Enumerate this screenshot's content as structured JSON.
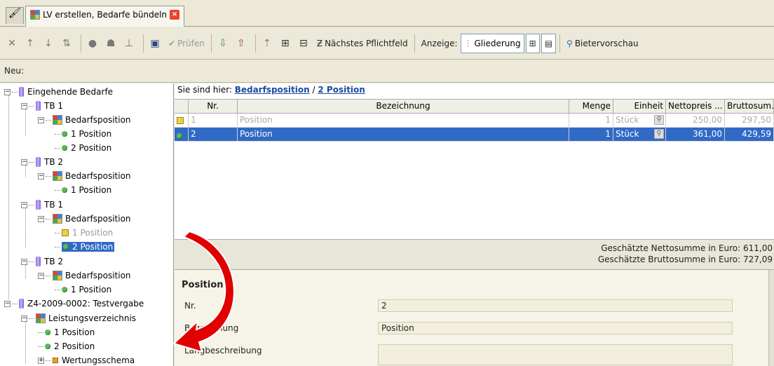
{
  "tabs": {
    "home_icon": "paint-brush-icon",
    "document_title": "LV erstellen, Bedarfe bündeln",
    "close_label": "×"
  },
  "toolbar": {
    "pruefen": "Prüfen",
    "naechstes_pflichtfeld": "Nächstes Pflichtfeld",
    "anzeige": "Anzeige:",
    "gliederung": "Gliederung",
    "bietervorschau": "Bietervorschau"
  },
  "neu_label": "Neu:",
  "tree": [
    {
      "label": "Eingehende Bedarfe",
      "icon": "cylinder-icon"
    },
    {
      "label": "TB 1",
      "icon": "cylinder-icon"
    },
    {
      "label": "Bedarfsposition",
      "icon": "blocks-icon"
    },
    {
      "label": "1 Position",
      "icon": "green-dot-icon"
    },
    {
      "label": "2 Position",
      "icon": "green-dot-icon"
    },
    {
      "label": "TB 2",
      "icon": "cylinder-icon"
    },
    {
      "label": "Bedarfsposition",
      "icon": "blocks-icon"
    },
    {
      "label": "1 Position",
      "icon": "green-dot-icon"
    },
    {
      "label": "TB 1",
      "icon": "cylinder-icon"
    },
    {
      "label": "Bedarfsposition",
      "icon": "blocks-icon"
    },
    {
      "label": "1 Position",
      "icon": "yellow-box-icon"
    },
    {
      "label": "2 Position",
      "icon": "green-dot-icon"
    },
    {
      "label": "TB 2",
      "icon": "cylinder-icon"
    },
    {
      "label": "Bedarfsposition",
      "icon": "blocks-icon"
    },
    {
      "label": "1 Position",
      "icon": "green-dot-icon"
    },
    {
      "label": "Z4-2009-0002:  Testvergabe",
      "icon": "cylinder-icon"
    },
    {
      "label": "Leistungsverzeichnis",
      "icon": "blocks-icon"
    },
    {
      "label": "1 Position",
      "icon": "green-dot-icon"
    },
    {
      "label": "2 Position",
      "icon": "green-dot-icon"
    },
    {
      "label": "Wertungsschema",
      "icon": "orange-box-icon"
    }
  ],
  "breadcrumb": {
    "prefix": "Sie sind hier:",
    "link1": "Bedarfsposition",
    "separator": "/",
    "link2": "2 Position"
  },
  "grid": {
    "columns": [
      "",
      "Nr.",
      "Bezeichnung",
      "Menge",
      "Einheit",
      "Nettopreis ...",
      "Bruttosum."
    ],
    "rows": [
      {
        "nr": "1",
        "bezeichnung": "Position",
        "menge": "1",
        "einheit": "Stück",
        "netto": "250,00",
        "brutto": "297,50"
      },
      {
        "nr": "2",
        "bezeichnung": "Position",
        "menge": "1",
        "einheit": "Stück",
        "netto": "361,00",
        "brutto": "429,59"
      }
    ]
  },
  "sums": {
    "netto": "Geschätzte Nettosumme in Euro: 611,00",
    "brutto": "Geschätzte Bruttosumme in Euro: 727,09"
  },
  "detail": {
    "title": "Position",
    "nr_label": "Nr.",
    "nr_value": "2",
    "bez_label": "Bezeichnung",
    "bez_value": "Position",
    "lang_label": "Langbeschreibung",
    "lang_value": ""
  },
  "colors": {
    "selection": "#316ac5",
    "arrow": "#e00000",
    "link": "#1a4ba0"
  }
}
